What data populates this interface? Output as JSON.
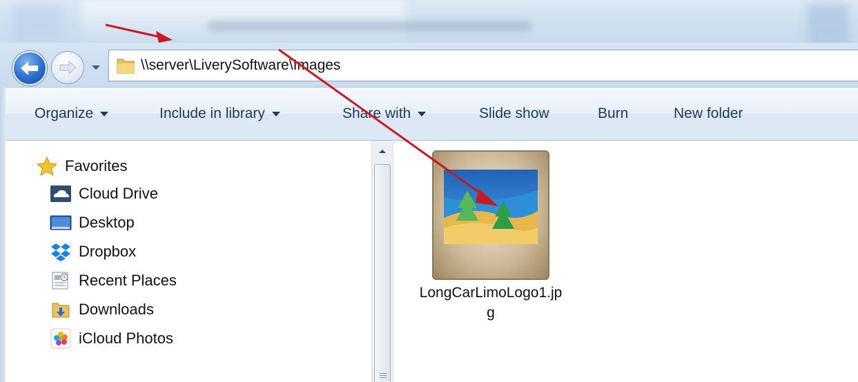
{
  "window": {
    "address_path": "\\\\server\\LiverySoftware\\Images"
  },
  "toolbar": {
    "items": [
      {
        "label": "Organize",
        "has_dropdown": true
      },
      {
        "label": "Include in library",
        "has_dropdown": true
      },
      {
        "label": "Share with",
        "has_dropdown": true
      },
      {
        "label": "Slide show",
        "has_dropdown": false
      },
      {
        "label": "Burn",
        "has_dropdown": false
      },
      {
        "label": "New folder",
        "has_dropdown": false
      }
    ]
  },
  "navigation": {
    "favorites_label": "Favorites",
    "items": [
      {
        "label": "Cloud Drive",
        "icon": "cloud-drive-icon"
      },
      {
        "label": "Desktop",
        "icon": "desktop-icon"
      },
      {
        "label": "Dropbox",
        "icon": "dropbox-icon"
      },
      {
        "label": "Recent Places",
        "icon": "recent-places-icon"
      },
      {
        "label": "Downloads",
        "icon": "downloads-icon"
      },
      {
        "label": "iCloud Photos",
        "icon": "icloud-photos-icon"
      }
    ]
  },
  "files": [
    {
      "name": "LongCarLimoLogo1.jpg",
      "icon": "image-file-icon"
    }
  ],
  "colors": {
    "annotation_arrow": "#c8191e",
    "command_text": "#1e395b",
    "back_button": "#2a6fcf"
  }
}
